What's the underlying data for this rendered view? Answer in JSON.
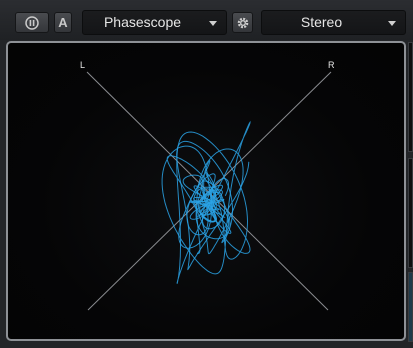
{
  "toolbar": {
    "pause_label": "pause",
    "auto_label": "A",
    "view_dropdown": "Phasescope",
    "mode_dropdown": "Stereo"
  },
  "scope": {
    "left_label": "L",
    "right_label": "R",
    "trace_color": "#2aa3e6"
  }
}
